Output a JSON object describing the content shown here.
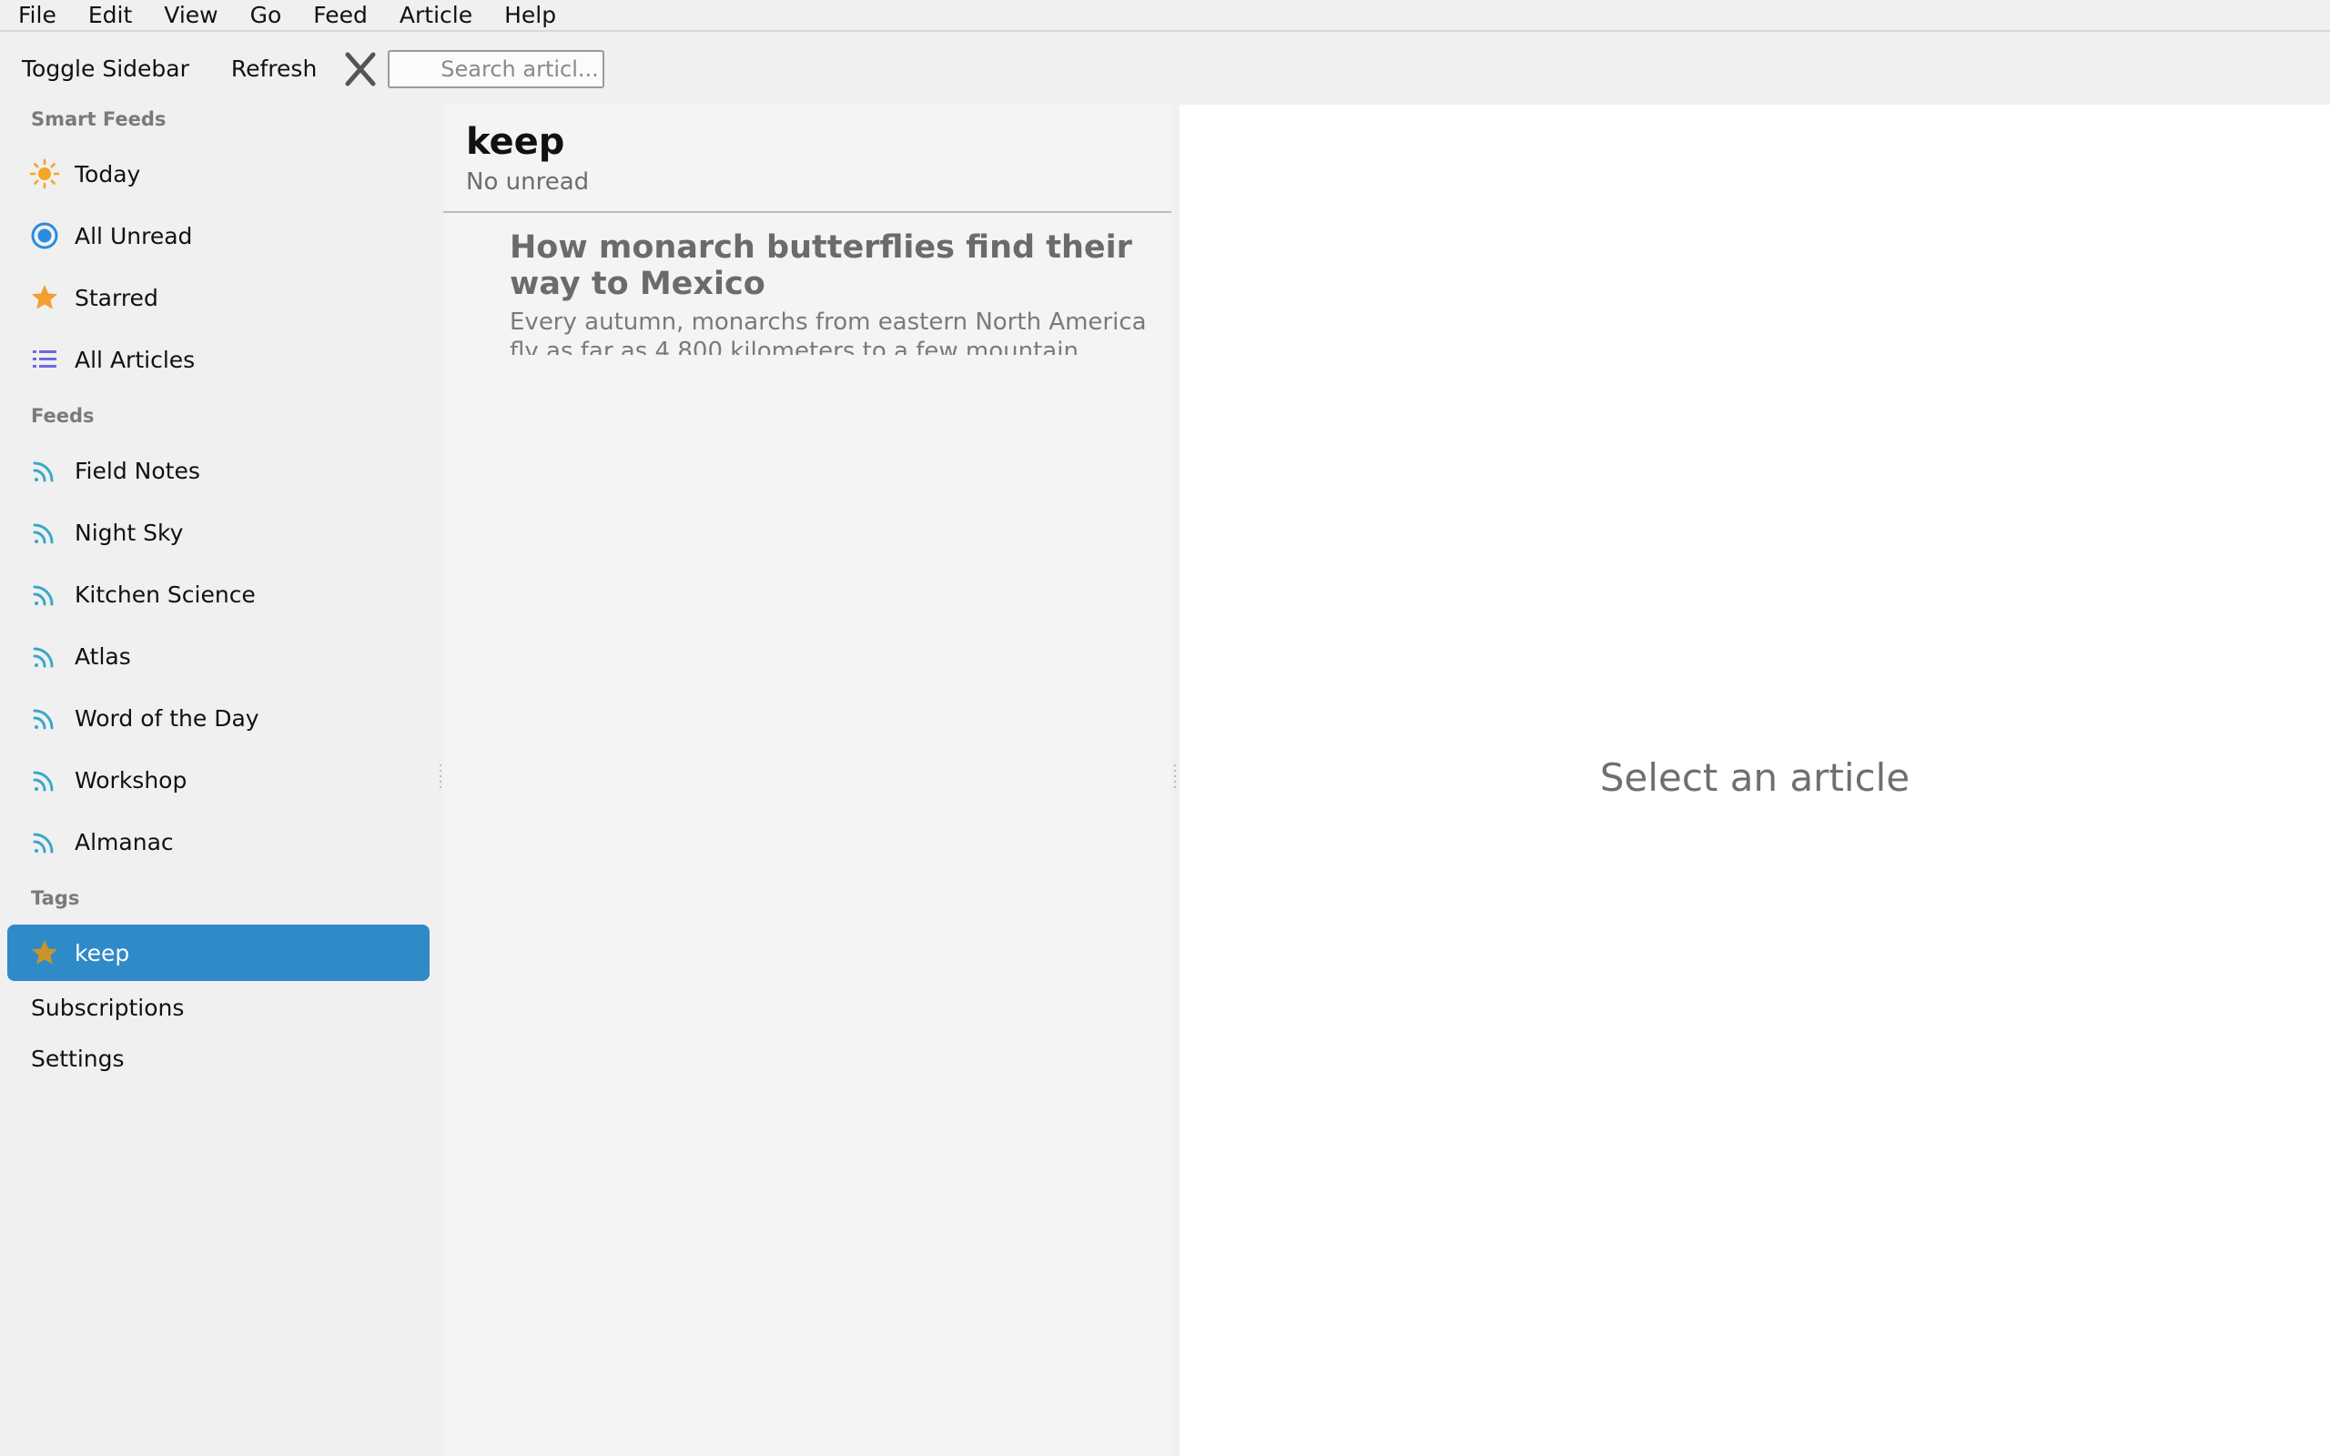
{
  "menubar": {
    "items": [
      "File",
      "Edit",
      "View",
      "Go",
      "Feed",
      "Article",
      "Help"
    ]
  },
  "toolbar": {
    "toggle_sidebar": "Toggle Sidebar",
    "refresh": "Refresh",
    "search_placeholder": "Search articl..."
  },
  "sidebar": {
    "smart_feeds_label": "Smart Feeds",
    "smart_feeds": [
      {
        "label": "Today",
        "icon": "sun-icon"
      },
      {
        "label": "All Unread",
        "icon": "unread-dot-icon"
      },
      {
        "label": "Starred",
        "icon": "star-icon"
      },
      {
        "label": "All Articles",
        "icon": "list-icon"
      }
    ],
    "feeds_label": "Feeds",
    "feeds": [
      {
        "label": "Field Notes",
        "icon": "rss-icon"
      },
      {
        "label": "Night Sky",
        "icon": "rss-icon"
      },
      {
        "label": "Kitchen Science",
        "icon": "rss-icon"
      },
      {
        "label": "Atlas",
        "icon": "rss-icon"
      },
      {
        "label": "Word of the Day",
        "icon": "rss-icon"
      },
      {
        "label": "Workshop",
        "icon": "rss-icon"
      },
      {
        "label": "Almanac",
        "icon": "rss-icon"
      }
    ],
    "tags_label": "Tags",
    "tags": [
      {
        "label": "keep",
        "icon": "star-icon",
        "selected": true
      }
    ],
    "subscriptions": "Subscriptions",
    "settings": "Settings"
  },
  "list": {
    "title": "keep",
    "subtitle": "No unread",
    "articles": [
      {
        "title": "How monarch butterflies find their way to Mexico",
        "summary": "Every autumn, monarchs from eastern North America fly as far as 4,800 kilometers to a few mountain forests in..."
      }
    ]
  },
  "reader": {
    "empty_message": "Select an article"
  },
  "colors": {
    "selection": "#2f8ac8",
    "sun": "#f5a623",
    "unread": "#2b8ce0",
    "star": "#f0a030",
    "list": "#6a6ae0",
    "rss": "#3aa7c9"
  }
}
